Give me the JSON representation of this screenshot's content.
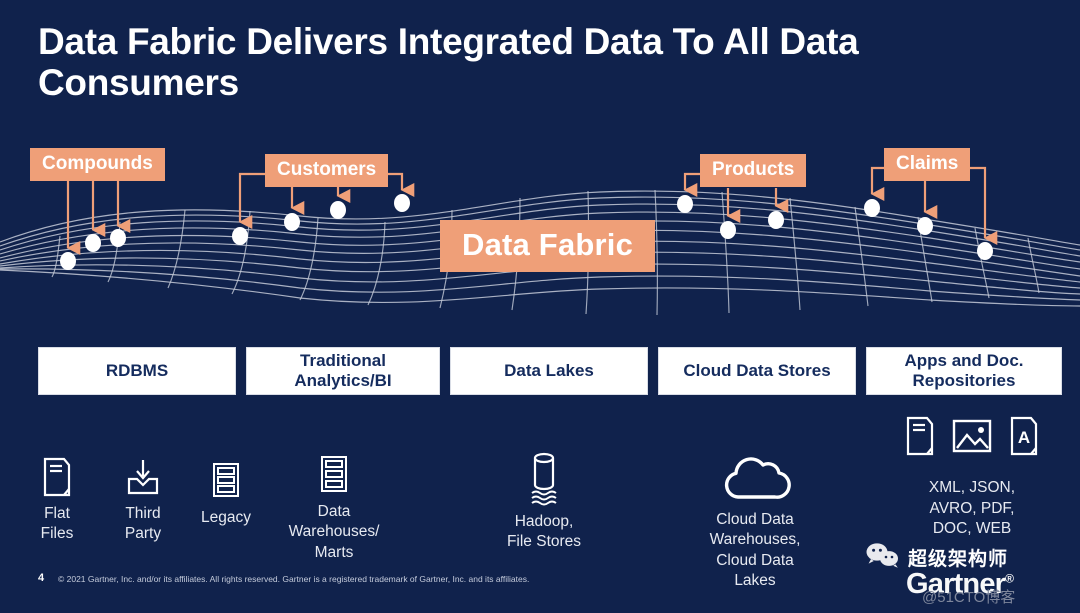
{
  "slide": {
    "title": "Data Fabric Delivers Integrated Data To All Data Consumers",
    "background_color": "#10224c",
    "accent_color": "#ef9f78",
    "page_number": "4",
    "copyright": "© 2021 Gartner, Inc. and/or its affiliates. All rights reserved. Gartner is a registered trademark of Gartner, Inc. and its affiliates."
  },
  "fabric": {
    "center_label": "Data Fabric",
    "sources": [
      {
        "label": "Compounds",
        "arrows": 3
      },
      {
        "label": "Customers",
        "arrows": 4
      },
      {
        "label": "Products",
        "arrows": 3
      },
      {
        "label": "Claims",
        "arrows": 3
      }
    ]
  },
  "consumers": {
    "boxes": [
      {
        "label": "RDBMS"
      },
      {
        "label": "Traditional\nAnalytics/BI"
      },
      {
        "label": "Data Lakes"
      },
      {
        "label": "Cloud Data Stores"
      },
      {
        "label": "Apps and Doc.\nRepositories"
      }
    ],
    "items": [
      {
        "icon": "document-icon",
        "label": "Flat\nFiles"
      },
      {
        "icon": "download-inbox-icon",
        "label": "Third\nParty"
      },
      {
        "icon": "server-rack-icon",
        "label": "Legacy"
      },
      {
        "icon": "server-rack-icon",
        "label": "Data\nWarehouses/\nMarts"
      },
      {
        "icon": "database-waves-icon",
        "label": "Hadoop,\nFile Stores"
      },
      {
        "icon": "cloud-icon",
        "label": "Cloud Data\nWarehouses,\nCloud Data\nLakes"
      },
      {
        "icon": "document-icon",
        "label": ""
      },
      {
        "icon": "image-icon",
        "label": ""
      },
      {
        "icon": "document-a-icon",
        "label": "XML, JSON,\nAVRO, PDF,\nDOC, WEB"
      }
    ]
  },
  "watermarks": {
    "wechat_name": "超级架构师",
    "gartner": "Gartner",
    "site": "@51CTO博客"
  }
}
